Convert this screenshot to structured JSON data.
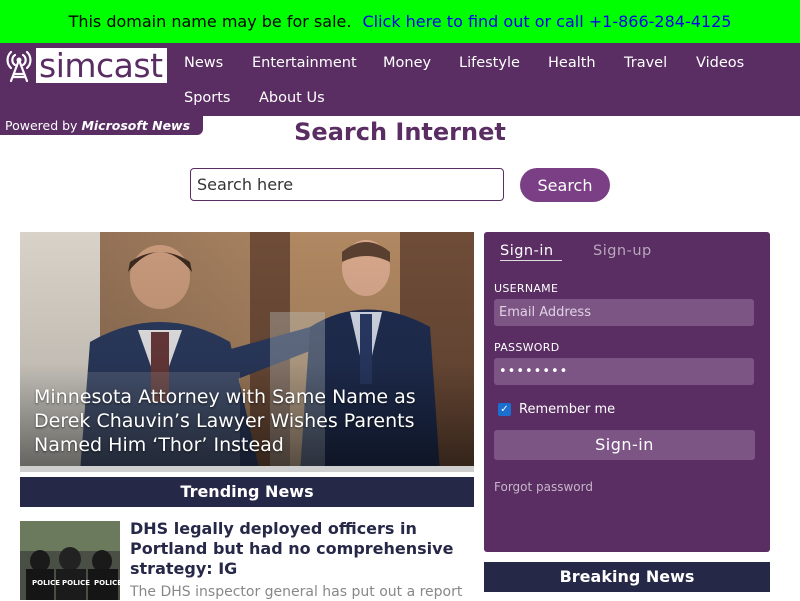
{
  "banner": {
    "text": "This domain name may be for sale.",
    "link": "Click here to find out or call +1-866-284-4125",
    "bg_color": "#00ff00",
    "link_color": "#0000ee"
  },
  "header": {
    "logo_text": "simcast",
    "logo_icon": "radio-tower-icon",
    "powered_prefix": "Powered by",
    "powered_brand": "Microsoft News",
    "nav": [
      "News",
      "Entertainment",
      "Money",
      "Lifestyle",
      "Health",
      "Travel",
      "Videos",
      "Sports",
      "About Us"
    ],
    "bg_color": "#5a2d63"
  },
  "search": {
    "title": "Search Internet",
    "placeholder": "Search here",
    "button_label": "Search"
  },
  "hero": {
    "title": "Minnesota Attorney with Same Name as Derek Chauvin’s Lawyer Wishes Parents Named Him ‘Thor’ Instead"
  },
  "trending": {
    "heading": "Trending News",
    "articles": [
      {
        "title": "DHS legally deployed officers in Portland but had no comprehensive strategy: IG",
        "summary": "The DHS inspector general has put out a report"
      }
    ]
  },
  "login": {
    "tabs": [
      "Sign-in",
      "Sign-up"
    ],
    "username_label": "USERNAME",
    "username_placeholder": "Email Address",
    "password_label": "PASSWORD",
    "password_value": "••••••••",
    "remember_label": "Remember me",
    "remember_checked": true,
    "submit_label": "Sign-in",
    "forgot_label": "Forgot password"
  },
  "breaking": {
    "heading": "Breaking News"
  }
}
